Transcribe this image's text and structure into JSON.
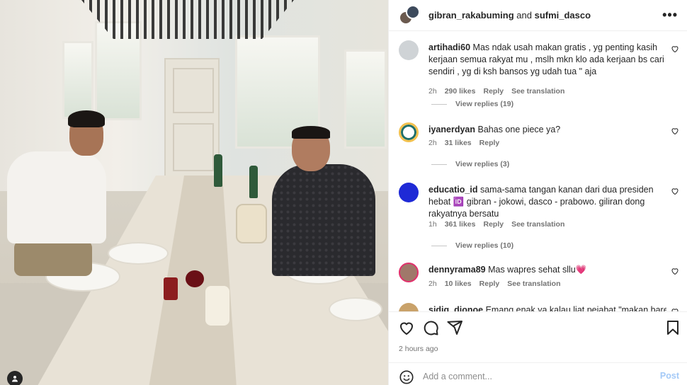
{
  "post": {
    "authors": {
      "user1": "gibran_rakabuming",
      "joiner": "and",
      "user2": "sufmi_dasco"
    },
    "more_icon": "more-horizontal-icon",
    "timestamp": "2 hours ago"
  },
  "comments": [
    {
      "username": "artihadi60",
      "text": "Mas ndak usah makan gratis , yg penting kasih kerjaan semua rakyat mu , mslh mkn klo ada kerjaan bs cari sendiri , yg di ksh bansos yg udah tua \" aja",
      "time": "2h",
      "likes": "290 likes",
      "reply": "Reply",
      "translate": "See translation",
      "replies": "View replies (19)"
    },
    {
      "username": "iyanerdyan",
      "text": "Bahas one piece ya?",
      "time": "2h",
      "likes": "31 likes",
      "reply": "Reply",
      "replies": "View replies (3)"
    },
    {
      "username": "educatio_id",
      "text": "sama-sama tangan kanan dari dua presiden hebat 🆔 gibran - jokowi, dasco - prabowo. giliran dong rakyatnya bersatu",
      "time": "1h",
      "likes": "361 likes",
      "reply": "Reply",
      "translate": "See translation",
      "replies": "View replies (10)"
    },
    {
      "username": "dennyrama89",
      "text": "Mas wapres sehat sllu💗",
      "time": "2h",
      "likes": "10 likes",
      "reply": "Reply",
      "translate": "See translation"
    },
    {
      "username": "sidiq_djonoe",
      "text": "Emang enak ya kalau liat pejabat \"makan bareng\""
    }
  ],
  "actions": {
    "like_icon": "heart-icon",
    "comment_icon": "comment-icon",
    "share_icon": "send-icon",
    "save_icon": "bookmark-icon"
  },
  "add_comment": {
    "placeholder": "Add a comment...",
    "post_label": "Post",
    "emoji_icon": "emoji-icon"
  },
  "colors": {
    "text": "#262626",
    "secondary": "#737373",
    "border": "#efefef",
    "post_disabled": "#a3c9f7",
    "heart_emoji": "#e0245e"
  }
}
